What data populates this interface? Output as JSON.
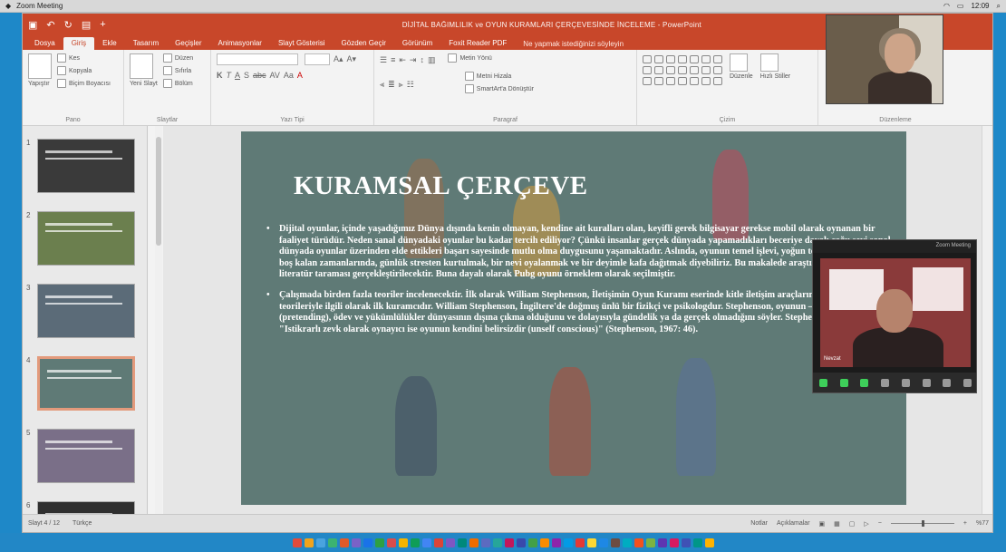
{
  "system_bar": {
    "app_name": "Zoom Meeting",
    "clock": "12:09"
  },
  "window": {
    "title": "DİJİTAL BAĞIMLILIK ve OYUN KURAMLARI ÇERÇEVESİNDE İNCELEME - PowerPoint",
    "quick_access": [
      "save",
      "undo",
      "redo",
      "present",
      "add"
    ]
  },
  "ribbon_tabs": [
    {
      "label": "Dosya",
      "active": false
    },
    {
      "label": "Giriş",
      "active": true
    },
    {
      "label": "Ekle",
      "active": false
    },
    {
      "label": "Tasarım",
      "active": false
    },
    {
      "label": "Geçişler",
      "active": false
    },
    {
      "label": "Animasyonlar",
      "active": false
    },
    {
      "label": "Slayt Gösterisi",
      "active": false
    },
    {
      "label": "Gözden Geçir",
      "active": false
    },
    {
      "label": "Görünüm",
      "active": false
    },
    {
      "label": "Foxit Reader PDF",
      "active": false
    }
  ],
  "tell_me": "Ne yapmak istediğinizi söyleyin",
  "ribbon": {
    "clipboard": {
      "cut": "Kes",
      "copy": "Kopyala",
      "format_painter": "Biçim Boyacısı",
      "label": "Pano",
      "paste": "Yapıştır"
    },
    "slides": {
      "new_slide": "Yeni Slayt",
      "layout": "Düzen",
      "reset": "Sıfırla",
      "section": "Bölüm",
      "label": "Slaytlar"
    },
    "font": {
      "label": "Yazı Tipi"
    },
    "paragraph": {
      "text_direction": "Metin Yönü",
      "align_text": "Metni Hizala",
      "smartart": "SmartArt'a Dönüştür",
      "label": "Paragraf"
    },
    "drawing": {
      "arrange": "Düzenle",
      "quick_styles": "Hızlı Stiller",
      "label": "Çizim"
    },
    "editing": {
      "label": "Düzenleme"
    }
  },
  "thumbnails": [
    {
      "num": "1",
      "color": "#3a3a3a"
    },
    {
      "num": "2",
      "color": "#6b7f4e"
    },
    {
      "num": "3",
      "color": "#5b6b78"
    },
    {
      "num": "4",
      "color": "#5f7a76",
      "active": true
    },
    {
      "num": "5",
      "color": "#7a6f88"
    },
    {
      "num": "6",
      "color": "#2f2f2f"
    }
  ],
  "slide": {
    "title": "KURAMSAL ÇERÇEVE",
    "bullets": [
      "Dijital oyunlar, içinde yaşadığımız Dünya dışında kenin olmayan, kendine ait kuralları olan, keyifli gerek bilgisayar gerekse mobil olarak oynanan bir faaliyet türüdür. Neden sanal dünyadaki oyunlar bu kadar tercih ediliyor? Çünkü insanlar gerçek dünyada yapamadıkları beceriye dayalı çoğu şeyi sanal dünyada oyunlar üzerinden elde ettikleri başarı sayesinde mutlu olma duygusunu yaşamaktadır. Aslında, oyunun temel işlevi, yoğun tempoda çalışanların boş kalan zamanlarında, günlük stresten kurtulmak, bir nevi oyalanmak ve bir deyimle kafa dağıtmak diyebiliriz. Bu makalede araştırma yöntemi olarak literatür taraması gerçekleştirilecektir. Buna dayalı olarak Pubg oyunu örneklem olarak seçilmiştir.",
      "Çalışmada birden fazla teoriler incelenecektir. İlk olarak William Stephenson, İletişimin Oyun Kuramı eserinde kitle iletişim araçlarının, toplumu oyun teorileriyle ilgili olarak ilk kuramcıdır. William Stephenson, İngiltere'de doğmuş ünlü bir fizikçi ve psikologdur. Stephenson, oyunun –mış gibi yapma (pretending), ödev ve yükümlülükler dünyasının dışına çıkma olduğunu ve dolayısıyla gündelik ya da gerçek olmadığını söyler. Stephenson şunu da ekler: \"Istikrarlı zevk olarak oynayıcı ise oyunun kendini belirsizdir (unself conscious)\" (Stephenson, 1967: 46)."
    ]
  },
  "status_bar": {
    "slide_info": "Slayt 4 / 12",
    "language": "Türkçe",
    "notes": "Notlar",
    "comments": "Açıklamalar",
    "zoom": "%77"
  },
  "zoom_meeting": {
    "header_text": "Zoom Meeting",
    "participant_name": "Nevzat"
  },
  "colors": {
    "ppt_accent": "#c8472a",
    "slide_bg": "#5f7a76",
    "taskbar": "#2287c6"
  },
  "taskbar_icons": [
    "#e24b3c",
    "#f0a31c",
    "#4aa3df",
    "#3cb371",
    "#e05a2a",
    "#7a62c7",
    "#1a73e8",
    "#2ea043",
    "#d94c4c",
    "#f4b400",
    "#0f9d58",
    "#4285f4",
    "#db4437",
    "#7e57c2",
    "#00897b",
    "#ef6c00",
    "#5c6bc0",
    "#26a69a",
    "#c2185b",
    "#3949ab",
    "#43a047",
    "#fb8c00",
    "#8e24aa",
    "#039be5",
    "#e53935",
    "#fdd835",
    "#1e88e5",
    "#6d4c41",
    "#00acc1",
    "#f4511e",
    "#7cb342",
    "#5e35b1",
    "#d81b60",
    "#3f51b5",
    "#009688",
    "#ffb300"
  ]
}
